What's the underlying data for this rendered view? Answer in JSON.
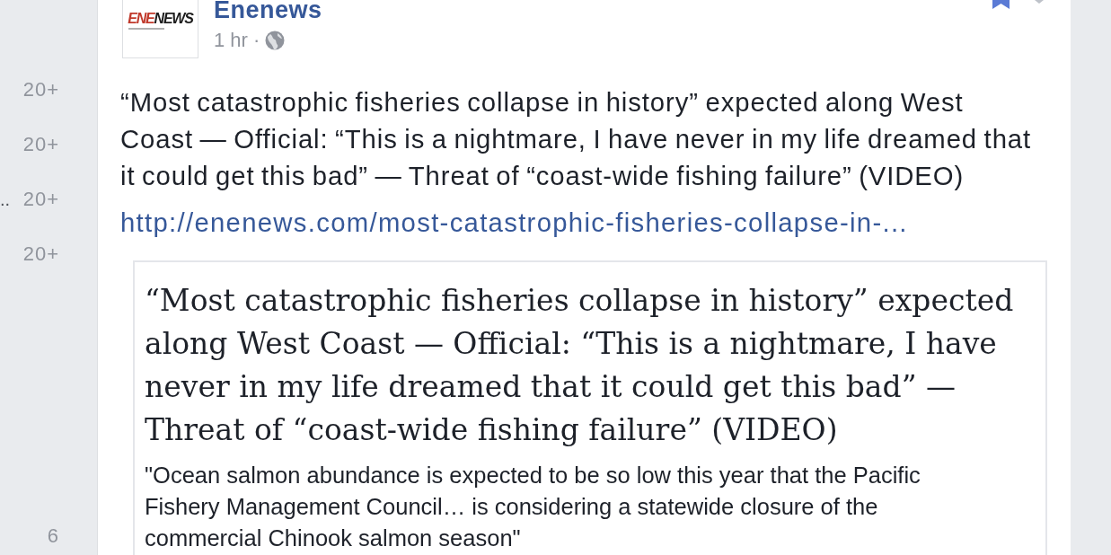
{
  "sidebar": {
    "items": [
      {
        "count": "20+"
      },
      {
        "count": "20+"
      },
      {
        "label": "..",
        "count": "20+"
      },
      {
        "count": "20+"
      },
      {
        "count": "6"
      }
    ]
  },
  "post": {
    "author": "Enenews",
    "avatar_logo": [
      "ENE",
      "NEWS"
    ],
    "time": "1 hr",
    "separator": "·",
    "text": "“Most catastrophic fisheries collapse in history” expected along West Coast — Official: “This is a nightmare, I have never in my life dreamed that it could get this bad” — Threat of “coast-wide fishing failure” (VIDEO)",
    "link": "http://enenews.com/most-catastrophic-fisheries-collapse-in-...",
    "preview": {
      "title": "“Most catastrophic fisheries collapse in history” expected along West Coast — Official: “This is a nightmare, I have never in my life dreamed that it could get this bad” — Threat of “coast-wide fishing failure” (VIDEO)",
      "description": "\"Ocean salmon abundance is expected to be so low this year that the Pacific Fishery Management Council… is considering a statewide closure of the commercial Chinook salmon season\""
    }
  }
}
